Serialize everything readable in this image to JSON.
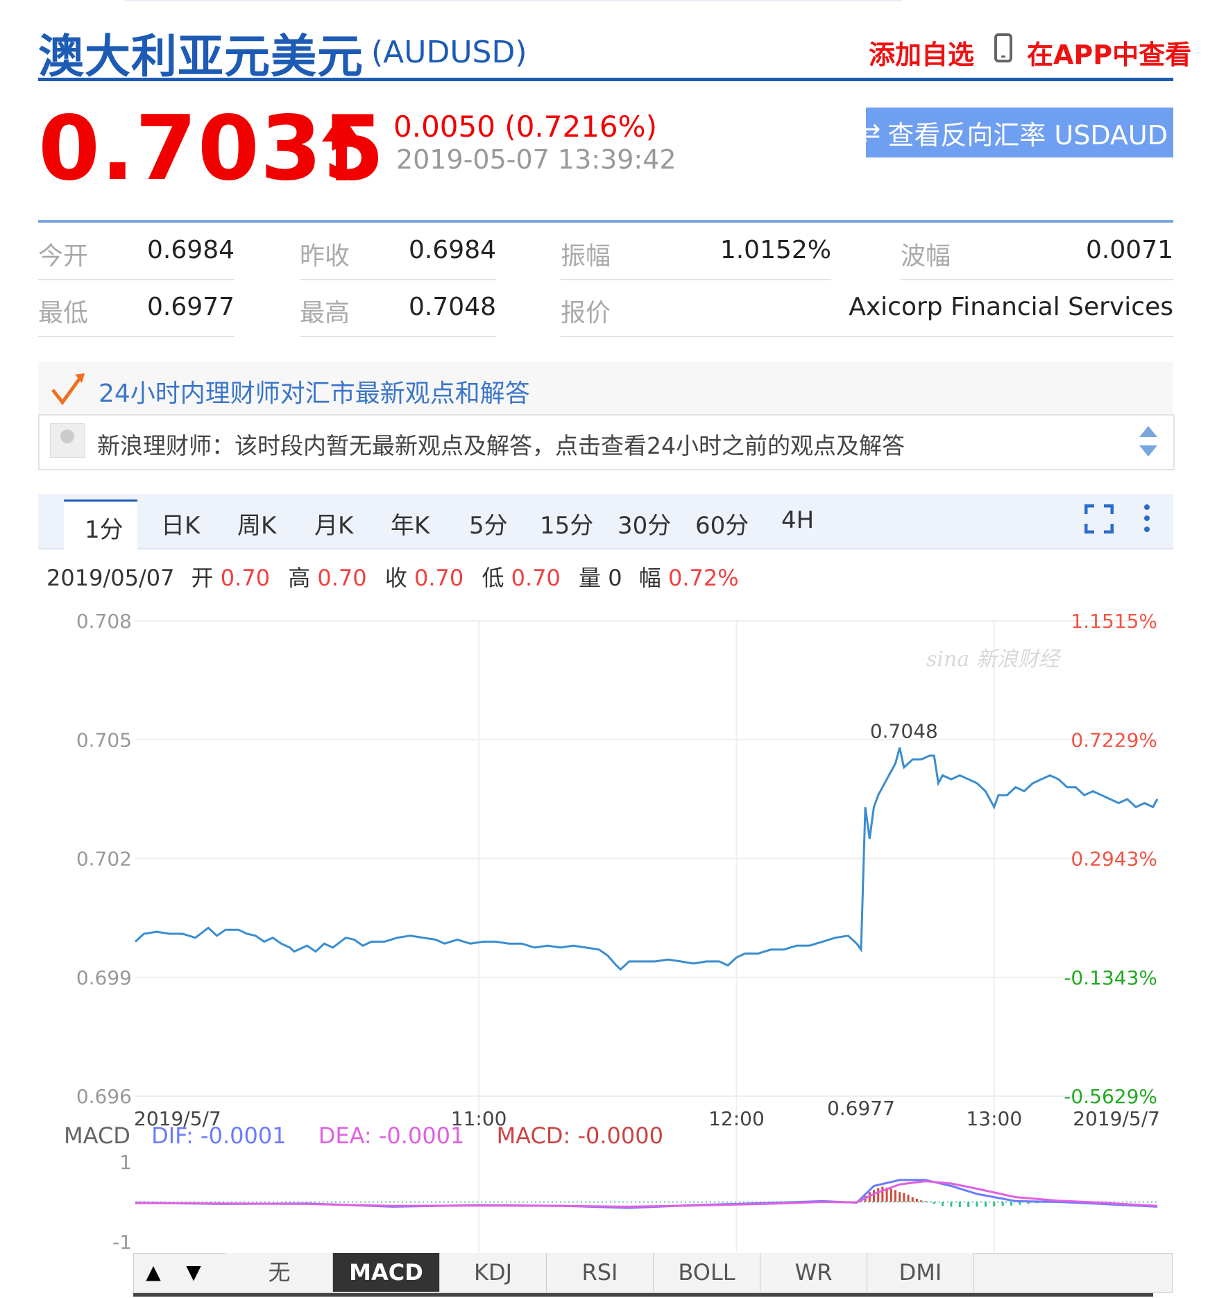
{
  "header": {
    "title": "澳大利亚元美元",
    "symbol": "(AUDUSD)",
    "add_watch": "添加自选",
    "app_view": "在APP中查看"
  },
  "quote": {
    "price": "0.7035",
    "change": "0.0050 (0.7216%)",
    "timestamp": "2019-05-07 13:39:42",
    "reverse_button": "查看反向汇率 USDAUD",
    "direction": "up",
    "up_color": "#f10000"
  },
  "stats": {
    "open_label": "今开",
    "open_value": "0.6984",
    "prev_close_label": "昨收",
    "prev_close_value": "0.6984",
    "amplitude_label": "振幅",
    "amplitude_value": "1.0152%",
    "range_label": "波幅",
    "range_value": "0.0071",
    "low_label": "最低",
    "low_value": "0.6977",
    "high_label": "最高",
    "high_value": "0.7048",
    "quote_label": "报价",
    "quote_value": "Axicorp Financial Services"
  },
  "advisor": {
    "title": "24小时内理财师对汇市最新观点和解答",
    "message": "新浪理财师：该时段内暂无最新观点及解答，点击查看24小时之前的观点及解答"
  },
  "tabs": [
    "1分",
    "日K",
    "周K",
    "月K",
    "年K",
    "5分",
    "15分",
    "30分",
    "60分",
    "4H"
  ],
  "active_tab": "1分",
  "ohlc": {
    "date": "2019/05/07",
    "open_label": "开",
    "open": "0.70",
    "high_label": "高",
    "high": "0.70",
    "close_label": "收",
    "close": "0.70",
    "low_label": "低",
    "low": "0.70",
    "volume_label": "量",
    "volume": "0",
    "amp_label": "幅",
    "amp": "0.72%"
  },
  "watermark": "sina 新浪财经",
  "chart_data": {
    "type": "line",
    "y_ticks": [
      "0.708",
      "0.705",
      "0.702",
      "0.699",
      "0.696"
    ],
    "y_right_ticks": [
      {
        "label": "1.1515%",
        "color": "#e54"
      },
      {
        "label": "0.7229%",
        "color": "#e54"
      },
      {
        "label": "0.2943%",
        "color": "#e54"
      },
      {
        "label": "-0.1343%",
        "color": "#2a2"
      },
      {
        "label": "-0.5629%",
        "color": "#2a2"
      }
    ],
    "ylim": [
      0.696,
      0.708
    ],
    "x_ticks": [
      "2019/5/7",
      "11:00",
      "12:00",
      "13:00",
      "2019/5/7"
    ],
    "x_range_minutes": [
      0,
      238
    ],
    "x_tick_minutes": [
      0,
      80,
      140,
      200,
      238
    ],
    "annotations": [
      {
        "label": "0.7048",
        "x": 179,
        "y": 0.7048
      },
      {
        "label": "0.6977",
        "x": 169,
        "y": 0.6977
      }
    ],
    "line_color": "#3a8dd0",
    "series": [
      {
        "values": [
          [
            0,
            0.6999
          ],
          [
            2,
            0.7001
          ],
          [
            5,
            0.70015
          ],
          [
            8,
            0.7001
          ],
          [
            11,
            0.7001
          ],
          [
            14,
            0.7
          ],
          [
            17,
            0.70025
          ],
          [
            19,
            0.70005
          ],
          [
            21,
            0.7002
          ],
          [
            24,
            0.7002
          ],
          [
            26,
            0.7001
          ],
          [
            28,
            0.70005
          ],
          [
            30,
            0.6999
          ],
          [
            32,
            0.7
          ],
          [
            34,
            0.69985
          ],
          [
            36,
            0.69975
          ],
          [
            37,
            0.69965
          ],
          [
            40,
            0.6998
          ],
          [
            42,
            0.69965
          ],
          [
            44,
            0.69985
          ],
          [
            46,
            0.69975
          ],
          [
            49,
            0.7
          ],
          [
            51,
            0.69995
          ],
          [
            53,
            0.6998
          ],
          [
            55,
            0.6999
          ],
          [
            58,
            0.6999
          ],
          [
            61,
            0.7
          ],
          [
            64,
            0.70005
          ],
          [
            67,
            0.7
          ],
          [
            70,
            0.69995
          ],
          [
            72,
            0.69985
          ],
          [
            75,
            0.69995
          ],
          [
            78,
            0.69985
          ],
          [
            81,
            0.6999
          ],
          [
            84,
            0.6999
          ],
          [
            87,
            0.69985
          ],
          [
            90,
            0.69985
          ],
          [
            93,
            0.69975
          ],
          [
            96,
            0.6998
          ],
          [
            99,
            0.69975
          ],
          [
            102,
            0.6998
          ],
          [
            105,
            0.69975
          ],
          [
            108,
            0.6997
          ],
          [
            110,
            0.69955
          ],
          [
            112,
            0.6993
          ],
          [
            113,
            0.6992
          ],
          [
            115,
            0.6994
          ],
          [
            118,
            0.6994
          ],
          [
            121,
            0.6994
          ],
          [
            124,
            0.69945
          ],
          [
            127,
            0.6994
          ],
          [
            130,
            0.69935
          ],
          [
            133,
            0.6994
          ],
          [
            136,
            0.6994
          ],
          [
            138,
            0.6993
          ],
          [
            140,
            0.6995
          ],
          [
            142,
            0.6996
          ],
          [
            145,
            0.6996
          ],
          [
            148,
            0.6997
          ],
          [
            151,
            0.6997
          ],
          [
            154,
            0.6998
          ],
          [
            157,
            0.6998
          ],
          [
            160,
            0.6999
          ],
          [
            163,
            0.7
          ],
          [
            166,
            0.70005
          ],
          [
            168,
            0.69985
          ],
          [
            169,
            0.6997
          ],
          [
            170,
            0.7033
          ],
          [
            171,
            0.7025
          ],
          [
            172,
            0.7033
          ],
          [
            173,
            0.7036
          ],
          [
            175,
            0.704
          ],
          [
            177,
            0.7044
          ],
          [
            178,
            0.7048
          ],
          [
            179,
            0.7043
          ],
          [
            181,
            0.7045
          ],
          [
            183,
            0.7045
          ],
          [
            185,
            0.7046
          ],
          [
            186,
            0.7046
          ],
          [
            187,
            0.7039
          ],
          [
            188,
            0.7041
          ],
          [
            190,
            0.704
          ],
          [
            192,
            0.7041
          ],
          [
            194,
            0.704
          ],
          [
            196,
            0.7039
          ],
          [
            198,
            0.7037
          ],
          [
            200,
            0.7033
          ],
          [
            201,
            0.7036
          ],
          [
            203,
            0.7036
          ],
          [
            205,
            0.7038
          ],
          [
            207,
            0.7037
          ],
          [
            209,
            0.7039
          ],
          [
            211,
            0.704
          ],
          [
            213,
            0.7041
          ],
          [
            215,
            0.704
          ],
          [
            217,
            0.7038
          ],
          [
            219,
            0.7038
          ],
          [
            221,
            0.7036
          ],
          [
            223,
            0.7037
          ],
          [
            225,
            0.7036
          ],
          [
            227,
            0.7035
          ],
          [
            229,
            0.7034
          ],
          [
            231,
            0.7035
          ],
          [
            233,
            0.7033
          ],
          [
            235,
            0.7034
          ],
          [
            237,
            0.7033
          ],
          [
            238,
            0.7035
          ]
        ]
      }
    ],
    "macd": {
      "label": "MACD",
      "dif_label": "DIF: -0.0001",
      "dea_label": "DEA: -0.0001",
      "macd_label": "MACD: -0.0000",
      "dif_color": "#6b7bff",
      "dea_color": "#e060e0",
      "macd_color": "#c44",
      "y_ticks": [
        "1",
        "-1"
      ],
      "ylim": [
        -1,
        1
      ],
      "dif": [
        [
          0,
          -0.02
        ],
        [
          20,
          -0.05
        ],
        [
          40,
          -0.04
        ],
        [
          60,
          -0.12
        ],
        [
          80,
          -0.08
        ],
        [
          100,
          -0.1
        ],
        [
          115,
          -0.15
        ],
        [
          130,
          -0.08
        ],
        [
          150,
          -0.02
        ],
        [
          160,
          0.02
        ],
        [
          168,
          -0.02
        ],
        [
          172,
          0.4
        ],
        [
          178,
          0.55
        ],
        [
          184,
          0.55
        ],
        [
          190,
          0.4
        ],
        [
          196,
          0.2
        ],
        [
          205,
          0.02
        ],
        [
          215,
          0.0
        ],
        [
          225,
          -0.05
        ],
        [
          238,
          -0.12
        ]
      ],
      "dea": [
        [
          0,
          -0.03
        ],
        [
          20,
          -0.04
        ],
        [
          40,
          -0.05
        ],
        [
          60,
          -0.1
        ],
        [
          80,
          -0.09
        ],
        [
          100,
          -0.1
        ],
        [
          115,
          -0.12
        ],
        [
          130,
          -0.09
        ],
        [
          150,
          -0.04
        ],
        [
          160,
          0.0
        ],
        [
          168,
          -0.01
        ],
        [
          172,
          0.2
        ],
        [
          178,
          0.44
        ],
        [
          184,
          0.52
        ],
        [
          190,
          0.46
        ],
        [
          196,
          0.33
        ],
        [
          205,
          0.12
        ],
        [
          215,
          0.03
        ],
        [
          225,
          -0.02
        ],
        [
          238,
          -0.1
        ]
      ],
      "hist": [
        [
          168,
          0.0
        ],
        [
          169,
          0.05
        ],
        [
          170,
          0.15
        ],
        [
          171,
          0.25
        ],
        [
          172,
          0.3
        ],
        [
          173,
          0.35
        ],
        [
          174,
          0.38
        ],
        [
          175,
          0.36
        ],
        [
          176,
          0.33
        ],
        [
          177,
          0.3
        ],
        [
          178,
          0.25
        ],
        [
          179,
          0.22
        ],
        [
          180,
          0.18
        ],
        [
          181,
          0.12
        ],
        [
          182,
          0.08
        ],
        [
          183,
          0.04
        ],
        [
          184,
          0.02
        ],
        [
          186,
          -0.05
        ],
        [
          188,
          -0.1
        ],
        [
          190,
          -0.12
        ],
        [
          192,
          -0.13
        ],
        [
          194,
          -0.13
        ],
        [
          196,
          -0.12
        ],
        [
          198,
          -0.12
        ],
        [
          200,
          -0.11
        ],
        [
          202,
          -0.1
        ],
        [
          204,
          -0.09
        ],
        [
          206,
          -0.07
        ],
        [
          208,
          -0.05
        ],
        [
          210,
          -0.03
        ],
        [
          212,
          -0.02
        ]
      ]
    }
  },
  "indicator_tabs": [
    "无",
    "MACD",
    "KDJ",
    "RSI",
    "BOLL",
    "WR",
    "DMI"
  ],
  "active_indicator": "MACD",
  "indicator_arrows": [
    "▲",
    "▼"
  ]
}
